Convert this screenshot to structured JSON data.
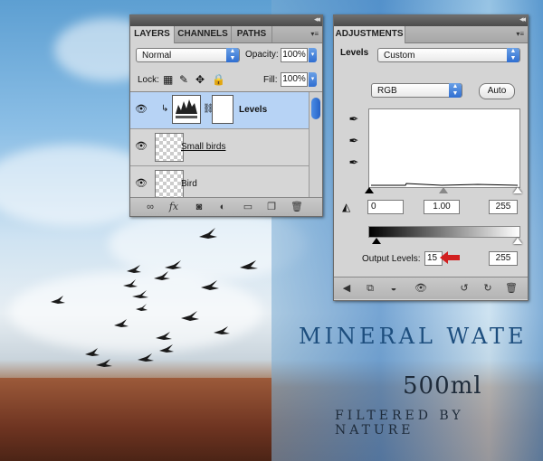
{
  "layers_panel": {
    "tabs": [
      "LAYERS",
      "CHANNELS",
      "PATHS"
    ],
    "blend_mode": "Normal",
    "opacity_label": "Opacity:",
    "opacity_value": "100%",
    "lock_label": "Lock:",
    "fill_label": "Fill:",
    "fill_value": "100%",
    "layers": [
      {
        "name": "Levels"
      },
      {
        "name": "Small birds"
      },
      {
        "name": "Bird"
      }
    ]
  },
  "adjustments_panel": {
    "tab": "ADJUSTMENTS",
    "title_label": "Levels",
    "preset": "Custom",
    "channel": "RGB",
    "auto_label": "Auto",
    "input_black": "0",
    "input_gamma": "1.00",
    "input_white": "255",
    "output_label": "Output Levels:",
    "output_black": "15",
    "output_white": "255"
  },
  "background": {
    "brand_text_1": "MINERAL WATE",
    "volume": "500ml",
    "tagline": "FILTERED BY NATURE"
  },
  "colors": {
    "selected_row": "#b7d3f5",
    "accent_blue": "#2f6ed1",
    "annotation_arrow": "#d12020"
  }
}
